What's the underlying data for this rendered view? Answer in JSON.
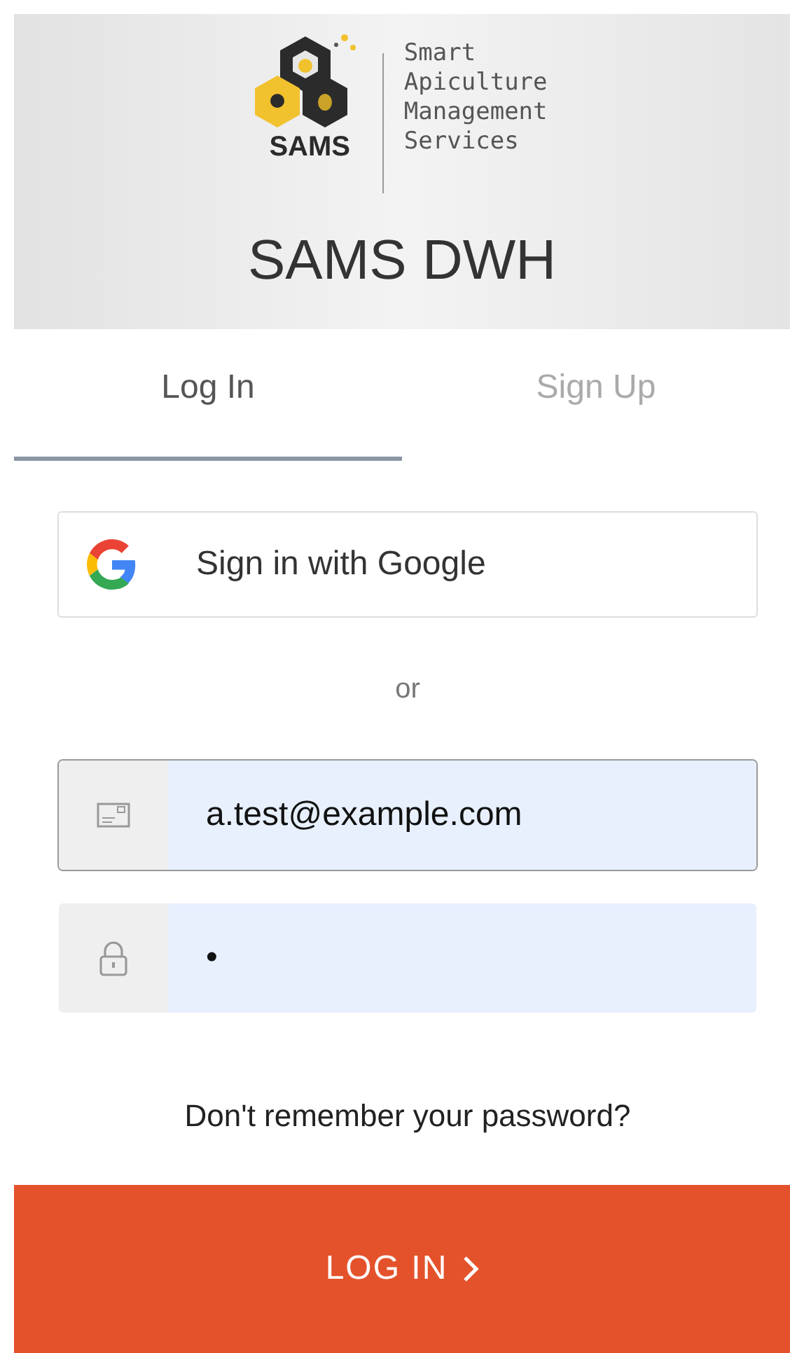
{
  "header": {
    "logo_mark": "SAMS",
    "logo_lines": [
      "Smart",
      "Apiculture",
      "Management",
      "Services"
    ],
    "title": "SAMS DWH"
  },
  "tabs": [
    {
      "label": "Log In",
      "selected": true
    },
    {
      "label": "Sign Up",
      "selected": false
    }
  ],
  "google_button": "Sign in with Google",
  "separator": "or",
  "fields": [
    {
      "kind": "email",
      "value": "a.test@example.com",
      "focused": true
    },
    {
      "kind": "password",
      "value": "•",
      "focused": false
    }
  ],
  "forgot_link": "Don't remember your password?",
  "submit_button": "LOG IN"
}
